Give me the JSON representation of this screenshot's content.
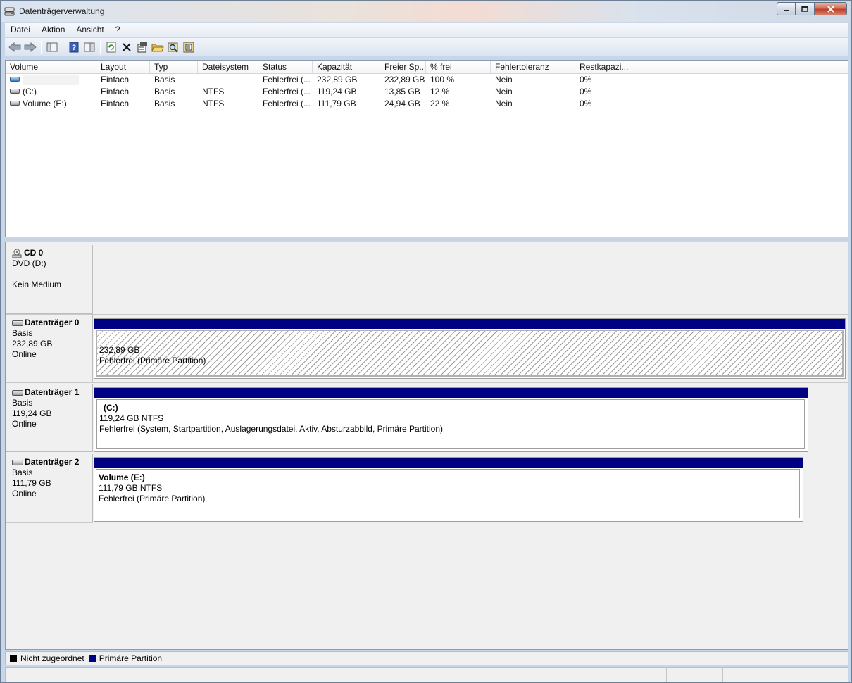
{
  "window": {
    "title": "Datenträgerverwaltung"
  },
  "menu": [
    "Datei",
    "Aktion",
    "Ansicht",
    "?"
  ],
  "toolbar": {
    "icons": [
      "back-arrow-icon",
      "forward-arrow-icon",
      "console-tree-icon",
      "help-icon",
      "console-view-icon",
      "refresh-icon",
      "delete-icon",
      "properties-icon",
      "open-icon",
      "explore-icon",
      "settings-icon"
    ]
  },
  "volume_list": {
    "columns": [
      "Volume",
      "Layout",
      "Typ",
      "Dateisystem",
      "Status",
      "Kapazität",
      "Freier Sp...",
      "% frei",
      "Fehlertoleranz",
      "Restkapazi..."
    ],
    "rows": [
      {
        "volume": "",
        "icon": "drive-blue",
        "layout": "Einfach",
        "typ": "Basis",
        "dateisystem": "",
        "status": "Fehlerfrei (...",
        "kapazitaet": "232,89 GB",
        "frei": "232,89 GB",
        "prozent": "100 %",
        "fehlertoleranz": "Nein",
        "rest": "0%"
      },
      {
        "volume": "(C:)",
        "icon": "drive-gray",
        "layout": "Einfach",
        "typ": "Basis",
        "dateisystem": "NTFS",
        "status": "Fehlerfrei (...",
        "kapazitaet": "119,24 GB",
        "frei": "13,85 GB",
        "prozent": "12 %",
        "fehlertoleranz": "Nein",
        "rest": "0%"
      },
      {
        "volume": "Volume (E:)",
        "icon": "drive-gray",
        "layout": "Einfach",
        "typ": "Basis",
        "dateisystem": "NTFS",
        "status": "Fehlerfrei (...",
        "kapazitaet": "111,79 GB",
        "frei": "24,94 GB",
        "prozent": "22 %",
        "fehlertoleranz": "Nein",
        "rest": "0%"
      }
    ]
  },
  "disks": {
    "cd0": {
      "name": "CD 0",
      "line1": "DVD (D:)",
      "line2": "",
      "line3": "Kein Medium"
    },
    "disk0": {
      "name": "Datenträger 0",
      "type": "Basis",
      "size": "232,89 GB",
      "state": "Online",
      "partition": {
        "label": "",
        "size": "232,89 GB",
        "status": "Fehlerfrei (Primäre Partition)"
      }
    },
    "disk1": {
      "name": "Datenträger 1",
      "type": "Basis",
      "size": "119,24 GB",
      "state": "Online",
      "partition": {
        "label": "(C:)",
        "size": "119,24 GB NTFS",
        "status": "Fehlerfrei (System, Startpartition, Auslagerungsdatei, Aktiv, Absturzabbild, Primäre Partition)"
      }
    },
    "disk2": {
      "name": "Datenträger 2",
      "type": "Basis",
      "size": "111,79 GB",
      "state": "Online",
      "partition": {
        "label": "Volume  (E:)",
        "size": "111,79 GB NTFS",
        "status": "Fehlerfrei (Primäre Partition)"
      }
    }
  },
  "legend": {
    "unallocated": {
      "label": "Nicht zugeordnet",
      "color": "#000000"
    },
    "primary": {
      "label": "Primäre Partition",
      "color": "#000082"
    }
  }
}
